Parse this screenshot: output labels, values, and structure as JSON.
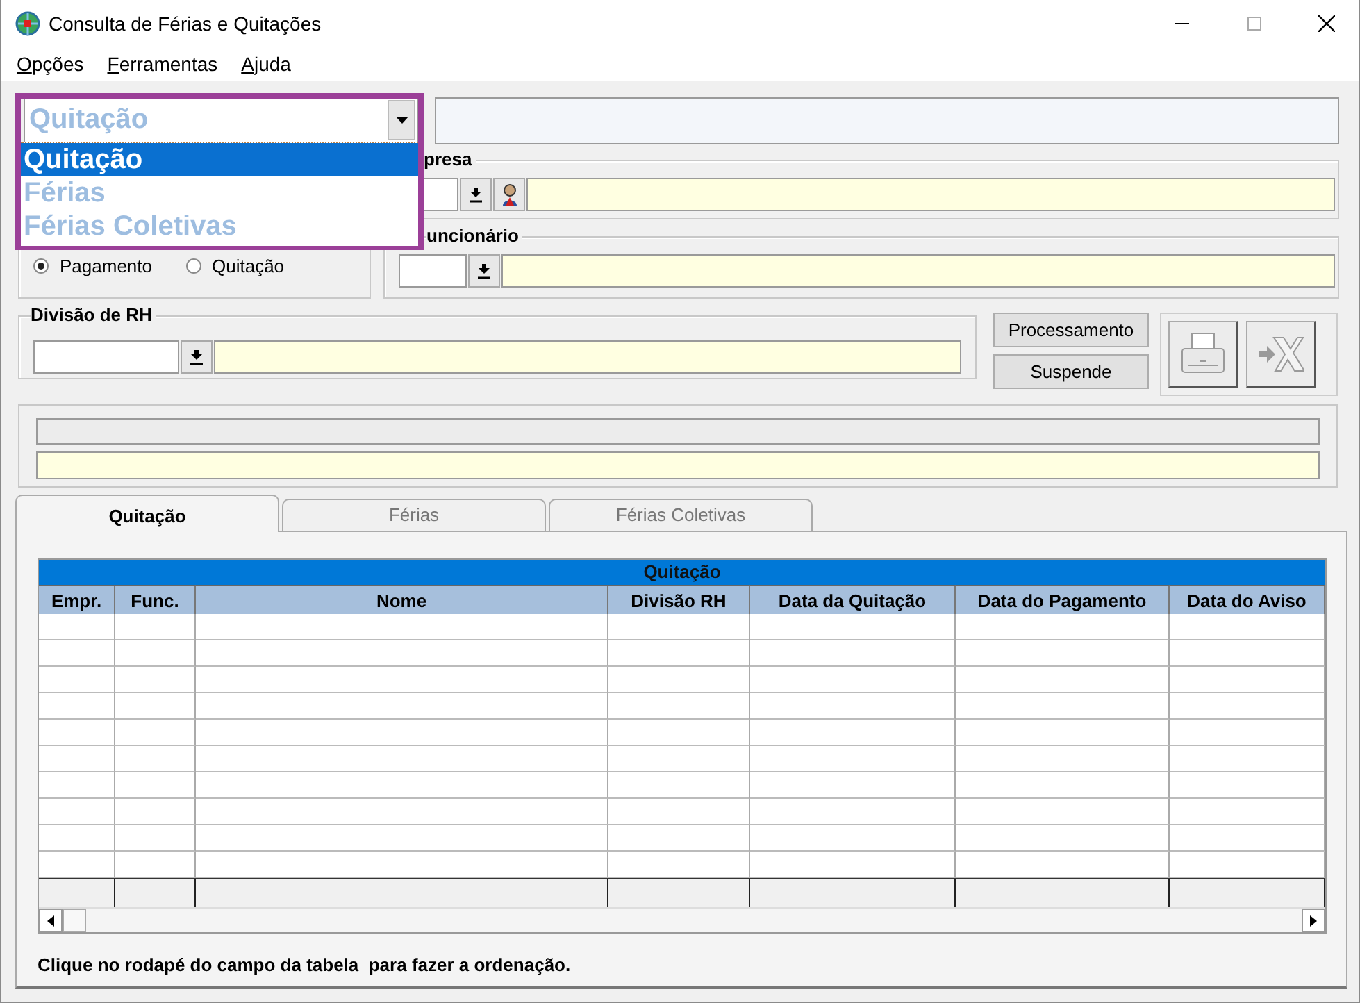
{
  "window": {
    "title": "Consulta de Férias e Quitações"
  },
  "menu": [
    {
      "key": "O",
      "rest": "pções"
    },
    {
      "key": "F",
      "rest": "erramentas"
    },
    {
      "key": "A",
      "rest": "juda"
    }
  ],
  "type_combo": {
    "value": "Quitação",
    "expanded": true,
    "options": [
      {
        "label": "Quitação",
        "selected": true
      },
      {
        "label": "Férias",
        "selected": false
      },
      {
        "label": "Férias Coletivas",
        "selected": false
      }
    ]
  },
  "empresa": {
    "label": "presa"
  },
  "funcionario": {
    "label": "uncionário"
  },
  "reference_date": {
    "options": [
      {
        "label": "Pagamento",
        "selected": true
      },
      {
        "label": "Quitação",
        "selected": false
      }
    ]
  },
  "division": {
    "label": "Divisão de RH"
  },
  "buttons": [
    "Processamento",
    "Suspende"
  ],
  "tools": [
    {
      "kind": "print",
      "disabled": true
    },
    {
      "kind": "export",
      "disabled": true
    }
  ],
  "tabs": [
    {
      "label": "Quitação",
      "selected": true
    },
    {
      "label": "Férias",
      "selected": false
    },
    {
      "label": "Férias Coletivas",
      "selected": false
    }
  ],
  "table": {
    "title": "Quitação",
    "columns": [
      "Empr.",
      "Func.",
      "Nome",
      "Divisão RH",
      "Data da Quitação",
      "Data do Pagamento",
      "Data do Aviso"
    ]
  },
  "hint": "Clique no rodapé do campo da tabela  para fazer a ordenação."
}
